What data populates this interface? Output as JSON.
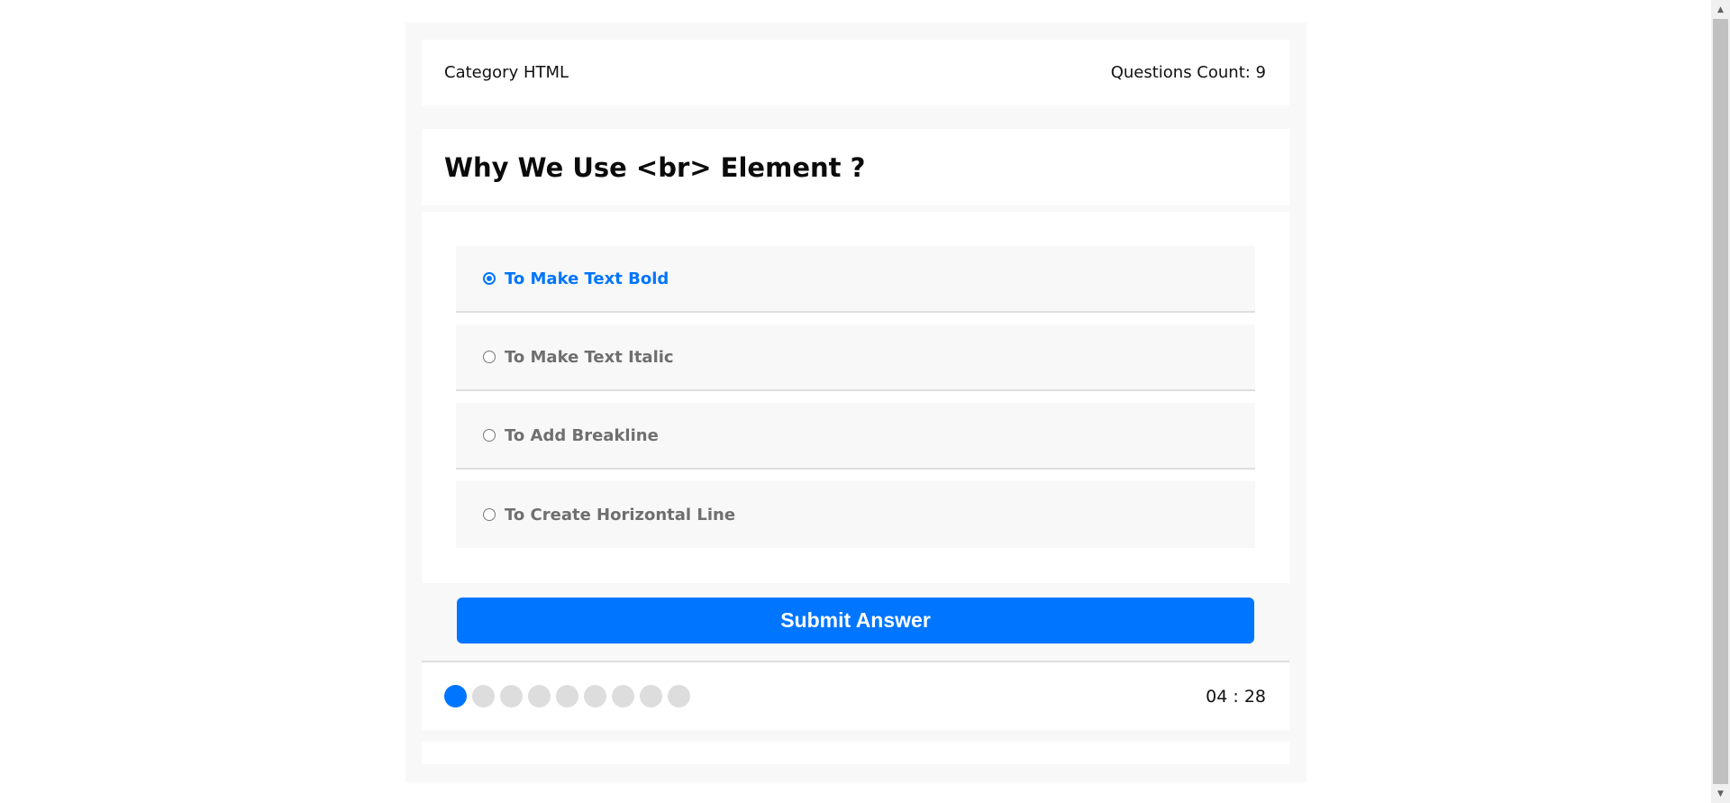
{
  "quiz_info": {
    "category": "Category HTML",
    "questions_count_label": "Questions Count: 9"
  },
  "question": {
    "title": "Why We Use <br> Element ?"
  },
  "answers": [
    {
      "label": "To Make Text Bold",
      "selected": true
    },
    {
      "label": "To Make Text Italic",
      "selected": false
    },
    {
      "label": "To Add Breakline",
      "selected": false
    },
    {
      "label": "To Create Horizontal Line",
      "selected": false
    }
  ],
  "submit": {
    "label": "Submit Answer"
  },
  "progress": {
    "current_question": 1,
    "total_questions": 9
  },
  "countdown": {
    "text": "04 : 28"
  },
  "colors": {
    "accent": "#0075ff",
    "panel_bg": "#f8f8f8",
    "bullet_inactive": "#dddddd",
    "answer_text": "#6f6f6f"
  },
  "scrollbar": {
    "up_icon": "▲",
    "down_icon": "▼"
  }
}
